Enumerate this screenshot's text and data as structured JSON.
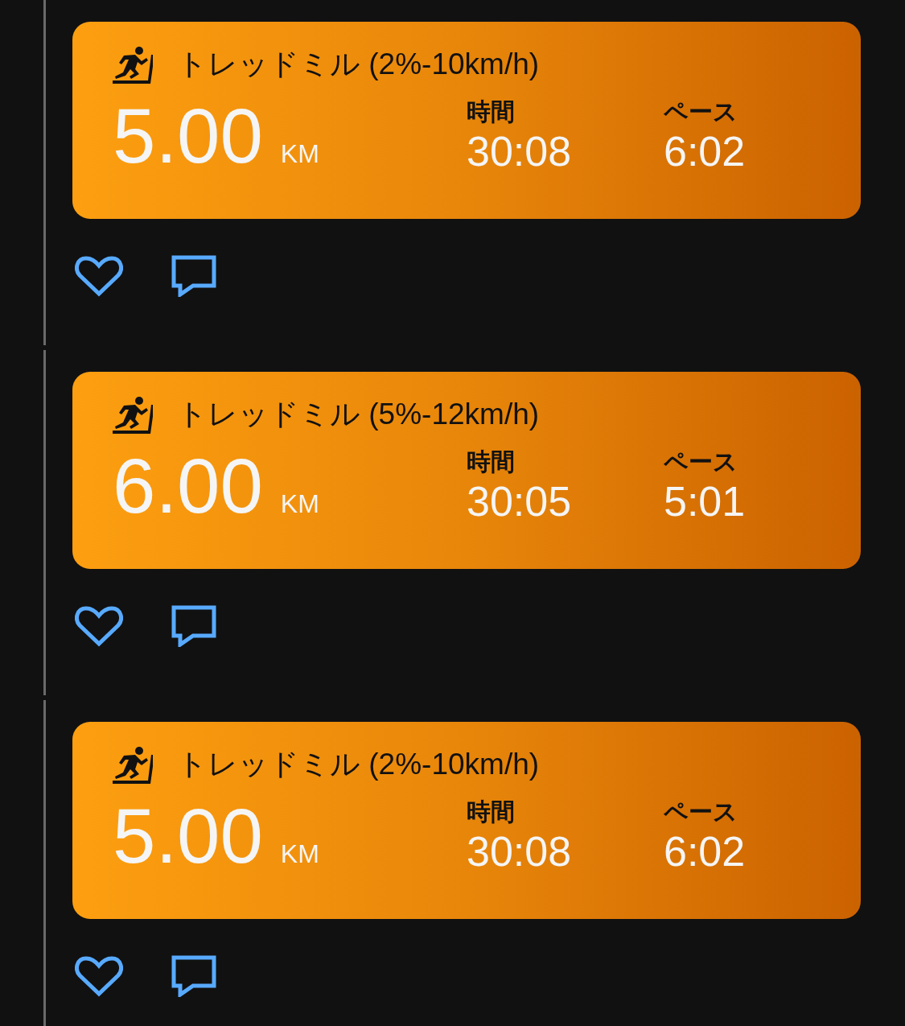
{
  "activities": [
    {
      "title": "トレッドミル (2%-10km/h)",
      "distance": "5.00",
      "distance_unit": "KM",
      "stats": [
        {
          "label": "時間",
          "value": "30:08"
        },
        {
          "label": "ペース",
          "value": "6:02"
        }
      ]
    },
    {
      "title": "トレッドミル (5%-12km/h)",
      "distance": "6.00",
      "distance_unit": "KM",
      "stats": [
        {
          "label": "時間",
          "value": "30:05"
        },
        {
          "label": "ペース",
          "value": "5:01"
        }
      ]
    },
    {
      "title": "トレッドミル (2%-10km/h)",
      "distance": "5.00",
      "distance_unit": "KM",
      "stats": [
        {
          "label": "時間",
          "value": "30:08"
        },
        {
          "label": "ペース",
          "value": "6:02"
        }
      ]
    }
  ]
}
